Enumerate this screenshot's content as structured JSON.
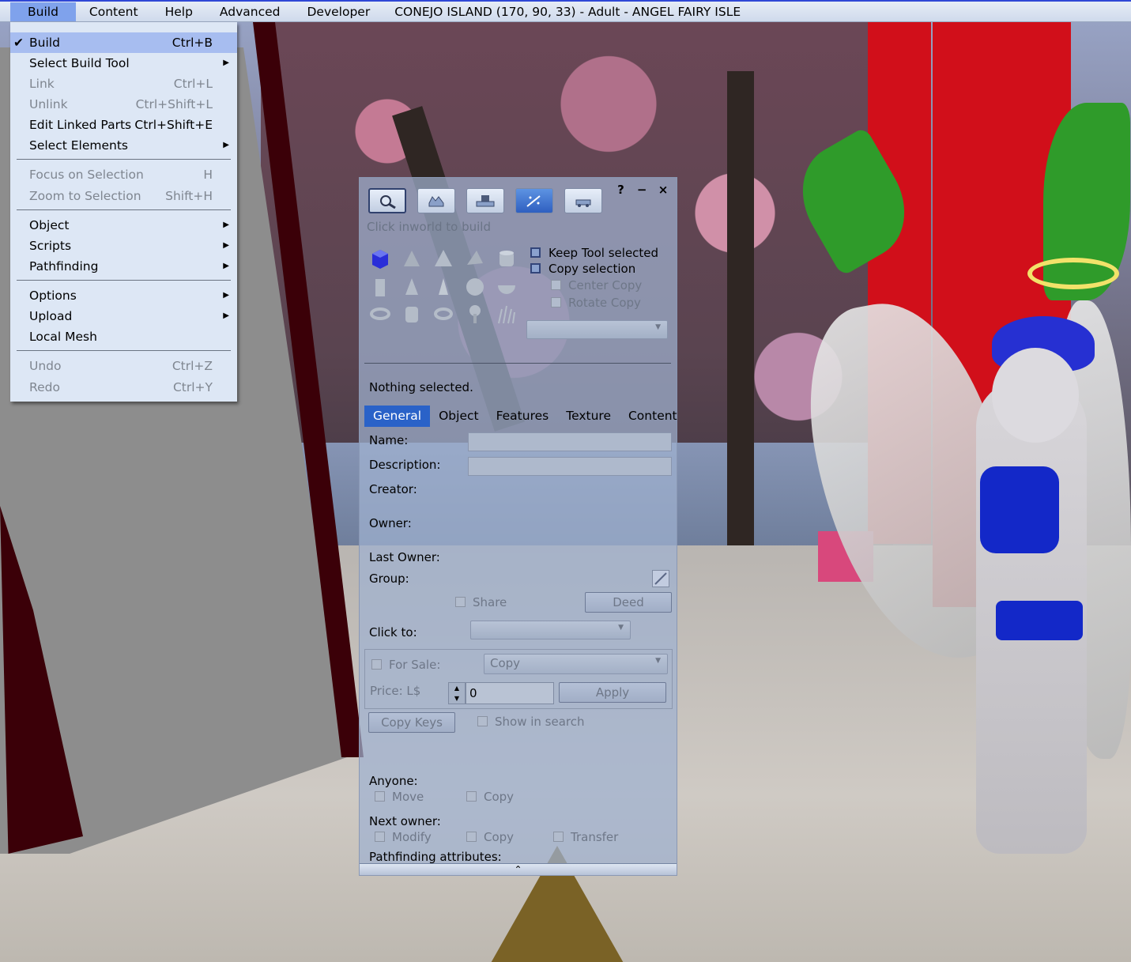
{
  "menubar": {
    "items": [
      "Build",
      "Content",
      "Help",
      "Advanced",
      "Developer"
    ],
    "region": "CONEJO ISLAND (170, 90, 33) - Adult - ANGEL FAIRY ISLE"
  },
  "build_menu": {
    "items": [
      {
        "label": "Build",
        "shortcut": "Ctrl+B",
        "checked": "✔"
      },
      {
        "label": "Select Build Tool",
        "submenu": "▶"
      },
      {
        "label": "Link",
        "shortcut": "Ctrl+L"
      },
      {
        "label": "Unlink",
        "shortcut": "Ctrl+Shift+L"
      },
      {
        "label": "Edit Linked Parts",
        "shortcut": "Ctrl+Shift+E"
      },
      {
        "label": "Select Elements",
        "submenu": "▶"
      },
      {
        "label": "Focus on Selection",
        "shortcut": "H"
      },
      {
        "label": "Zoom to Selection",
        "shortcut": "Shift+H"
      },
      {
        "label": "Object",
        "submenu": "▶"
      },
      {
        "label": "Scripts",
        "submenu": "▶"
      },
      {
        "label": "Pathfinding",
        "submenu": "▶"
      },
      {
        "label": "Options",
        "submenu": "▶"
      },
      {
        "label": "Upload",
        "submenu": "▶"
      },
      {
        "label": "Local Mesh"
      },
      {
        "label": "Undo",
        "shortcut": "Ctrl+Z"
      },
      {
        "label": "Redo",
        "shortcut": "Ctrl+Y"
      }
    ]
  },
  "build_floater": {
    "title_buttons": {
      "help": "?",
      "minimize": "−",
      "close": "×"
    },
    "tools": [
      "focus-tool",
      "move-tool",
      "edit-tool",
      "create-tool",
      "land-tool"
    ],
    "hint": "Click inworld to build",
    "keep_tool_selected": "Keep Tool selected",
    "copy_selection": "Copy selection",
    "center_copy": "Center Copy",
    "rotate_copy": "Rotate Copy",
    "status": "Nothing selected.",
    "tabs": [
      "General",
      "Object",
      "Features",
      "Texture",
      "Content"
    ],
    "general": {
      "name_label": "Name:",
      "description_label": "Description:",
      "creator_label": "Creator:",
      "owner_label": "Owner:",
      "last_owner_label": "Last Owner:",
      "group_label": "Group:",
      "share_label": "Share",
      "deed_button": "Deed",
      "click_to_label": "Click to:",
      "for_sale_label": "For Sale:",
      "sale_type": "Copy",
      "price_label": "Price: L$",
      "price_value": "0",
      "apply_button": "Apply",
      "copy_keys_button": "Copy Keys",
      "show_in_search": "Show in search",
      "anyone_label": "Anyone:",
      "anyone_move": "Move",
      "anyone_copy": "Copy",
      "next_owner_label": "Next owner:",
      "next_modify": "Modify",
      "next_copy": "Copy",
      "next_transfer": "Transfer",
      "pathfinding_label": "Pathfinding attributes:"
    },
    "expand_icon": "⌃"
  },
  "colors": {
    "menu_highlight": "#a7bdf0",
    "active_tab": "#2a62c8",
    "menubar_active": "#7fa2ec"
  }
}
